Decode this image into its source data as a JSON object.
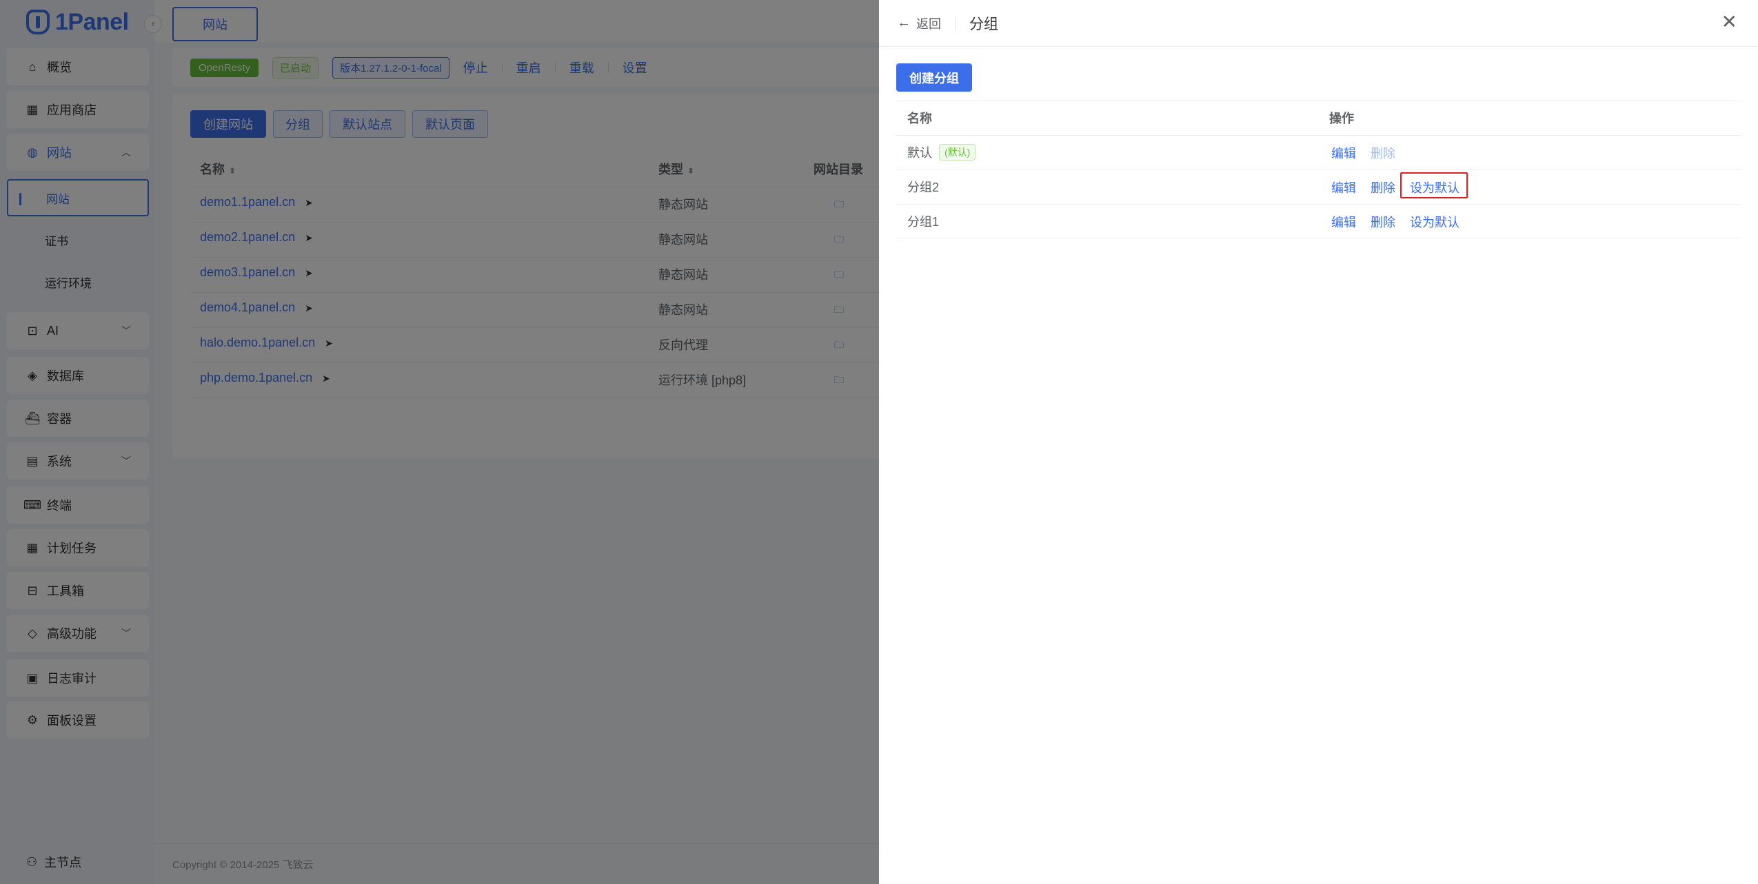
{
  "app": {
    "logo_text": "1Panel"
  },
  "sidebar": {
    "items": [
      {
        "label": "概览",
        "icon": "home-icon"
      },
      {
        "label": "应用商店",
        "icon": "grid-icon"
      },
      {
        "label": "网站",
        "icon": "globe-icon"
      },
      {
        "label": "AI",
        "icon": "robot-icon"
      },
      {
        "label": "数据库",
        "icon": "layers-icon"
      },
      {
        "label": "容器",
        "icon": "whale-icon"
      },
      {
        "label": "系统",
        "icon": "server-icon"
      },
      {
        "label": "终端",
        "icon": "terminal-icon"
      },
      {
        "label": "计划任务",
        "icon": "calendar-icon"
      },
      {
        "label": "工具箱",
        "icon": "toolbox-icon"
      },
      {
        "label": "高级功能",
        "icon": "diamond-icon"
      },
      {
        "label": "日志审计",
        "icon": "log-icon"
      },
      {
        "label": "面板设置",
        "icon": "gear-icon"
      }
    ],
    "website_sub": [
      "网站",
      "证书",
      "运行环境"
    ],
    "node": "主节点"
  },
  "main": {
    "tab": "网站",
    "status": {
      "app": "OpenResty",
      "state": "已启动",
      "version": "版本1.27.1.2-0-1-focal",
      "actions": [
        "停止",
        "重启",
        "重载",
        "设置"
      ]
    },
    "buttons": [
      "创建网站",
      "分组",
      "默认站点",
      "默认页面"
    ],
    "columns": [
      "名称",
      "类型",
      "网站目录"
    ],
    "rows": [
      {
        "name": "demo1.1panel.cn",
        "type": "静态网站"
      },
      {
        "name": "demo2.1panel.cn",
        "type": "静态网站"
      },
      {
        "name": "demo3.1panel.cn",
        "type": "静态网站"
      },
      {
        "name": "demo4.1panel.cn",
        "type": "静态网站"
      },
      {
        "name": "halo.demo.1panel.cn",
        "type": "反向代理"
      },
      {
        "name": "php.demo.1panel.cn",
        "type": "运行环境 [php8]"
      }
    ],
    "footer": "Copyright © 2014-2025 飞致云"
  },
  "drawer": {
    "back": "返回",
    "title": "分组",
    "create_button": "创建分组",
    "columns": [
      "名称",
      "操作"
    ],
    "default_tag": "(默认)",
    "rows": [
      {
        "name": "默认",
        "is_default": true,
        "actions": [
          "编辑",
          "删除"
        ]
      },
      {
        "name": "分组2",
        "is_default": false,
        "actions": [
          "编辑",
          "删除",
          "设为默认"
        ]
      },
      {
        "name": "分组1",
        "is_default": false,
        "actions": [
          "编辑",
          "删除",
          "设为默认"
        ]
      }
    ]
  }
}
